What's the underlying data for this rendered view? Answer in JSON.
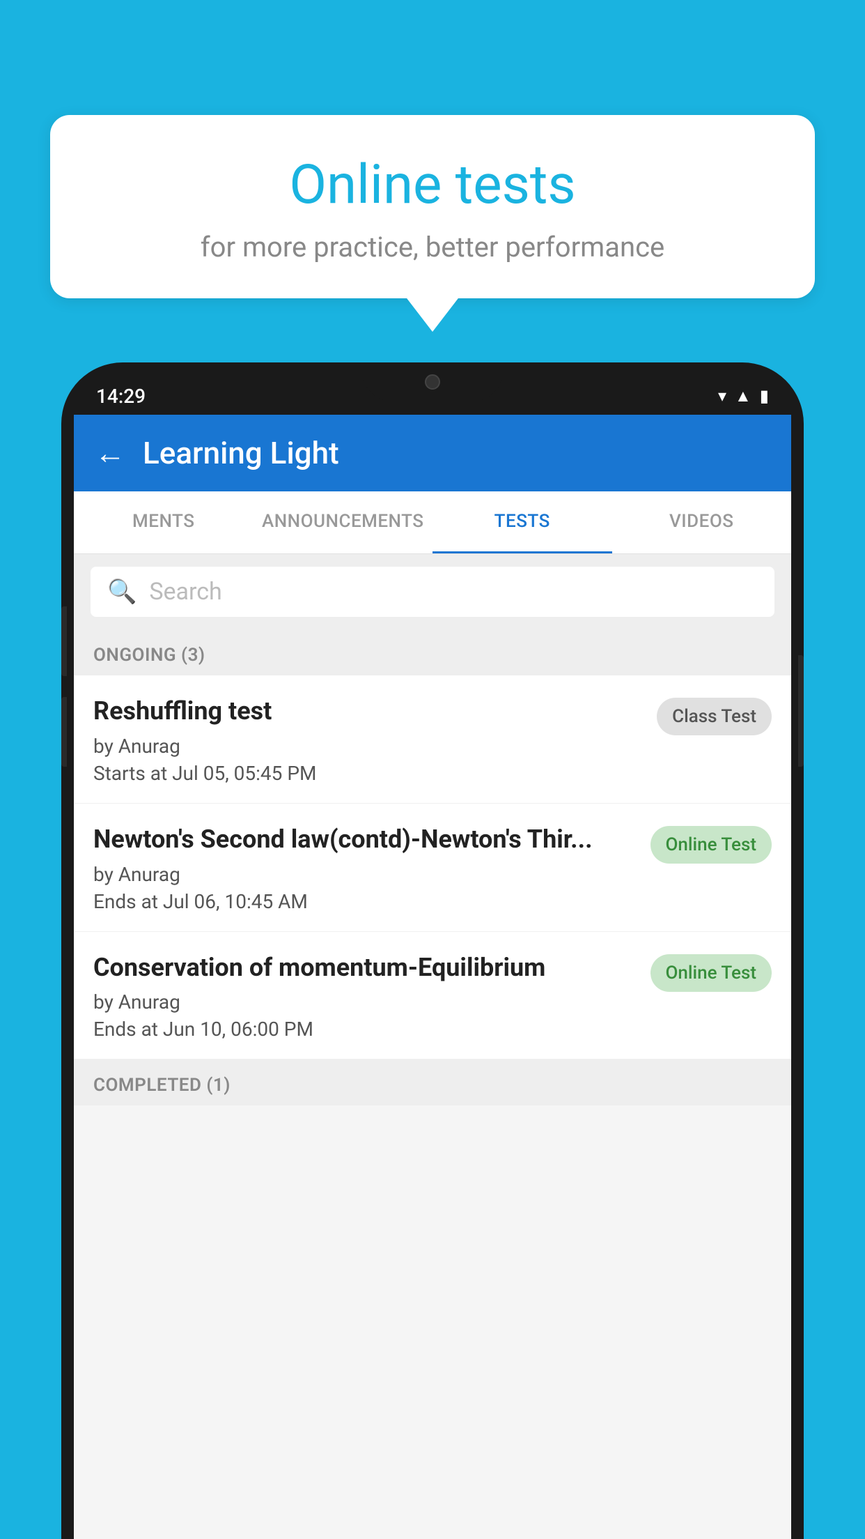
{
  "bubble": {
    "title": "Online tests",
    "subtitle": "for more practice, better performance"
  },
  "phone": {
    "time": "14:29",
    "app_title": "Learning Light",
    "back_label": "←"
  },
  "tabs": [
    {
      "label": "MENTS",
      "active": false
    },
    {
      "label": "ANNOUNCEMENTS",
      "active": false
    },
    {
      "label": "TESTS",
      "active": true
    },
    {
      "label": "VIDEOS",
      "active": false
    }
  ],
  "search": {
    "placeholder": "Search"
  },
  "ongoing_section": {
    "label": "ONGOING (3)"
  },
  "completed_section": {
    "label": "COMPLETED (1)"
  },
  "tests": [
    {
      "name": "Reshuffling test",
      "by": "by Anurag",
      "date": "Starts at  Jul 05, 05:45 PM",
      "badge": "Class Test",
      "badge_type": "class"
    },
    {
      "name": "Newton's Second law(contd)-Newton's Thir...",
      "by": "by Anurag",
      "date": "Ends at  Jul 06, 10:45 AM",
      "badge": "Online Test",
      "badge_type": "online"
    },
    {
      "name": "Conservation of momentum-Equilibrium",
      "by": "by Anurag",
      "date": "Ends at  Jun 10, 06:00 PM",
      "badge": "Online Test",
      "badge_type": "online"
    }
  ]
}
